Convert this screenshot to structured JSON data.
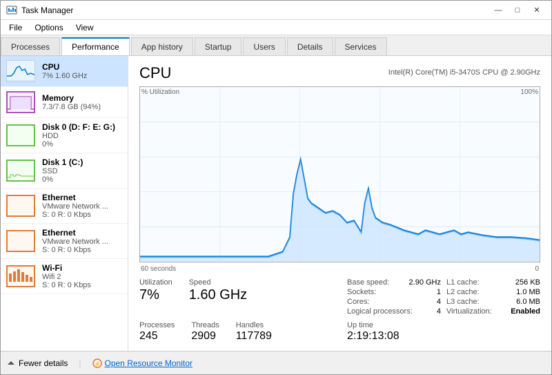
{
  "window": {
    "title": "Task Manager",
    "controls": {
      "minimize": "—",
      "maximize": "□",
      "close": "✕"
    }
  },
  "menu": {
    "items": [
      "File",
      "Options",
      "View"
    ]
  },
  "tabs": [
    {
      "label": "Processes",
      "active": false
    },
    {
      "label": "Performance",
      "active": true
    },
    {
      "label": "App history",
      "active": false
    },
    {
      "label": "Startup",
      "active": false
    },
    {
      "label": "Users",
      "active": false
    },
    {
      "label": "Details",
      "active": false
    },
    {
      "label": "Services",
      "active": false
    }
  ],
  "sidebar": {
    "items": [
      {
        "name": "CPU",
        "sub1": "7% 1.60 GHz",
        "sub2": "",
        "type": "cpu",
        "active": true
      },
      {
        "name": "Memory",
        "sub1": "7.3/7.8 GB (94%)",
        "sub2": "",
        "type": "memory",
        "active": false
      },
      {
        "name": "Disk 0 (D: F: E: G:)",
        "sub1": "HDD",
        "sub2": "0%",
        "type": "disk0",
        "active": false
      },
      {
        "name": "Disk 1 (C:)",
        "sub1": "SSD",
        "sub2": "0%",
        "type": "disk1",
        "active": false
      },
      {
        "name": "Ethernet",
        "sub1": "VMware Network ...",
        "sub2": "S: 0  R: 0 Kbps",
        "type": "eth0",
        "active": false
      },
      {
        "name": "Ethernet",
        "sub1": "VMware Network ...",
        "sub2": "S: 0  R: 0 Kbps",
        "type": "eth1",
        "active": false
      },
      {
        "name": "Wi-Fi",
        "sub1": "Wifi 2",
        "sub2": "S: 0  R: 0 Kbps",
        "type": "wifi",
        "active": false
      }
    ]
  },
  "main": {
    "title": "CPU",
    "model": "Intel(R) Core(TM) i5-3470S CPU @ 2.90GHz",
    "chart": {
      "y_label": "% Utilization",
      "y_max": "100%",
      "x_label_left": "60 seconds",
      "x_label_right": "0"
    },
    "stats": {
      "utilization_label": "Utilization",
      "utilization_value": "7%",
      "speed_label": "Speed",
      "speed_value": "1.60 GHz",
      "processes_label": "Processes",
      "processes_value": "245",
      "threads_label": "Threads",
      "threads_value": "2909",
      "handles_label": "Handles",
      "handles_value": "117789",
      "uptime_label": "Up time",
      "uptime_value": "2:19:13:08"
    },
    "details": {
      "base_speed_label": "Base speed:",
      "base_speed_value": "2.90 GHz",
      "sockets_label": "Sockets:",
      "sockets_value": "1",
      "cores_label": "Cores:",
      "cores_value": "4",
      "logical_label": "Logical processors:",
      "logical_value": "4",
      "virt_label": "Virtualization:",
      "virt_value": "Enabled",
      "l1_label": "L1 cache:",
      "l1_value": "256 KB",
      "l2_label": "L2 cache:",
      "l2_value": "1.0 MB",
      "l3_label": "L3 cache:",
      "l3_value": "6.0 MB"
    }
  },
  "bottom_bar": {
    "fewer_details_label": "Fewer details",
    "monitor_label": "Open Resource Monitor"
  }
}
